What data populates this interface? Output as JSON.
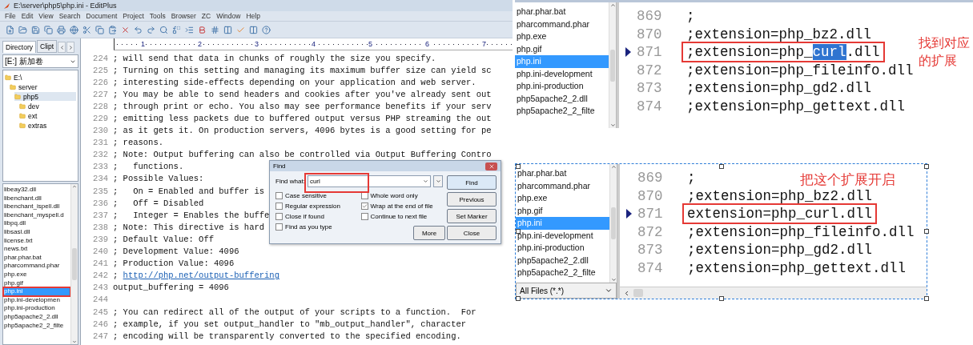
{
  "editor": {
    "title": "E:\\server\\php5\\php.ini - EditPlus",
    "menu": [
      "File",
      "Edit",
      "View",
      "Search",
      "Document",
      "Project",
      "Tools",
      "Browser",
      "ZC",
      "Window",
      "Help"
    ],
    "ruler": [
      "1",
      "2",
      "3",
      "4",
      "5",
      "6",
      "7"
    ],
    "sidebar": {
      "tabs": [
        {
          "label": "Directory",
          "selected": true
        },
        {
          "label": "Clipt",
          "selected": false
        }
      ],
      "drive": "[E:] 新加卷",
      "folders": [
        {
          "name": "E:\\",
          "selected": false,
          "children": [
            {
              "name": "server",
              "selected": false,
              "children": [
                {
                  "name": "php5",
                  "selected": true,
                  "children": [
                    {
                      "name": "dev",
                      "selected": false
                    },
                    {
                      "name": "ext",
                      "selected": false
                    },
                    {
                      "name": "extras",
                      "selected": false
                    }
                  ]
                }
              ]
            }
          ]
        }
      ],
      "files": [
        {
          "name": "libeay32.dll",
          "selected": false,
          "marked": false
        },
        {
          "name": "libenchant.dll",
          "selected": false,
          "marked": false
        },
        {
          "name": "libenchant_ispell.dll",
          "selected": false,
          "marked": false
        },
        {
          "name": "libenchant_myspell.d",
          "selected": false,
          "marked": false
        },
        {
          "name": "libpq.dll",
          "selected": false,
          "marked": false
        },
        {
          "name": "libsasl.dll",
          "selected": false,
          "marked": false
        },
        {
          "name": "license.txt",
          "selected": false,
          "marked": false
        },
        {
          "name": "news.txt",
          "selected": false,
          "marked": false
        },
        {
          "name": "phar.phar.bat",
          "selected": false,
          "marked": false
        },
        {
          "name": "pharcommand.phar",
          "selected": false,
          "marked": false
        },
        {
          "name": "php.exe",
          "selected": false,
          "marked": false
        },
        {
          "name": "php.gif",
          "selected": false,
          "marked": false
        },
        {
          "name": "php.ini",
          "selected": true,
          "marked": true
        },
        {
          "name": "php.ini-developmen",
          "selected": false,
          "marked": false
        },
        {
          "name": "php.ini-production",
          "selected": false,
          "marked": false
        },
        {
          "name": "php5apache2_2.dll",
          "selected": false,
          "marked": false
        },
        {
          "name": "php5apache2_2_filte",
          "selected": false,
          "marked": false
        }
      ]
    },
    "lines": [
      {
        "number": "224",
        "text": "; will send that data in chunks of roughly the size you specify."
      },
      {
        "number": "225",
        "text": "; Turning on this setting and managing its maximum buffer size can yield sc"
      },
      {
        "number": "226",
        "text": "; interesting side-effects depending on your application and web server."
      },
      {
        "number": "227",
        "text": "; You may be able to send headers and cookies after you've already sent out"
      },
      {
        "number": "228",
        "text": "; through print or echo. You also may see performance benefits if your serv"
      },
      {
        "number": "229",
        "text": "; emitting less packets due to buffered output versus PHP streaming the out"
      },
      {
        "number": "230",
        "text": "; as it gets it. On production servers, 4096 bytes is a good setting for pe"
      },
      {
        "number": "231",
        "text": "; reasons."
      },
      {
        "number": "232",
        "text": "; Note: Output buffering can also be controlled via Output Buffering Contro"
      },
      {
        "number": "233",
        "text": ";   functions."
      },
      {
        "number": "234",
        "text": "; Possible Values:"
      },
      {
        "number": "235",
        "text": ";   On = Enabled and buffer is"
      },
      {
        "number": "236",
        "text": ";   Off = Disabled"
      },
      {
        "number": "237",
        "text": ";   Integer = Enables the buffe"
      },
      {
        "number": "238",
        "text": "; Note: This directive is hard"
      },
      {
        "number": "239",
        "text": "; Default Value: Off"
      },
      {
        "number": "240",
        "text": "; Development Value: 4096"
      },
      {
        "number": "241",
        "text": "; Production Value: 4096"
      },
      {
        "number": "242",
        "text": "; ",
        "link": "http://php.net/output-buffering"
      },
      {
        "number": "243",
        "text": "output_buffering = 4096"
      },
      {
        "number": "244"
      },
      {
        "number": "245",
        "text": "; You can redirect all of the output of your scripts to a function.  For"
      },
      {
        "number": "246",
        "text": "; example, if you set output_handler to \"mb_output_handler\", character"
      },
      {
        "number": "247",
        "text": "; encoding will be transparently converted to the specified encoding."
      }
    ],
    "find_dialog": {
      "title": "Find",
      "label": "Find what:",
      "value": "curl",
      "marked": true,
      "options": [
        {
          "label": "Case sensitive",
          "checked": false
        },
        {
          "label": "Regular expression",
          "checked": false
        },
        {
          "label": "Close if found",
          "checked": false
        },
        {
          "label": "Find as you type",
          "checked": false
        },
        {
          "label": "Whole word only",
          "checked": false
        },
        {
          "label": "Wrap at the end of file",
          "checked": true
        },
        {
          "label": "Continue to next file",
          "checked": false
        }
      ],
      "buttons": [
        "Find",
        "Previous",
        "Set Marker",
        "More",
        "Close"
      ]
    }
  },
  "panels": [
    {
      "framed": false,
      "files": [
        {
          "name": "phar.phar.bat",
          "selected": false
        },
        {
          "name": "pharcommand.phar",
          "selected": false
        },
        {
          "name": "php.exe",
          "selected": false
        },
        {
          "name": "php.gif",
          "selected": false
        },
        {
          "name": "php.ini",
          "selected": true
        },
        {
          "name": "php.ini-development",
          "selected": false
        },
        {
          "name": "php.ini-production",
          "selected": false
        },
        {
          "name": "php5apache2_2.dll",
          "selected": false
        },
        {
          "name": "php5apache2_2_filte",
          "selected": false
        }
      ],
      "lines": [
        {
          "number": "869",
          "text": ";",
          "bookmark": false,
          "marked": false
        },
        {
          "number": "870",
          "text": ";extension=php_bz2.dll",
          "bookmark": false,
          "marked": false
        },
        {
          "number": "871",
          "text": ";extension=php_",
          "match": "curl",
          "rest": ".dll",
          "bookmark": true,
          "marked": true
        },
        {
          "number": "872",
          "text": ";extension=php_fileinfo.dll",
          "bookmark": false,
          "marked": false
        },
        {
          "number": "873",
          "text": ";extension=php_gd2.dll",
          "bookmark": false,
          "marked": false
        },
        {
          "number": "874",
          "text": ";extension=php_gettext.dll",
          "bookmark": false,
          "marked": false
        }
      ],
      "note": {
        "kind": "side",
        "text": "找到对应的扩展"
      }
    },
    {
      "framed": true,
      "filter": "All Files (*.*)",
      "files": [
        {
          "name": "phar.phar.bat",
          "selected": false
        },
        {
          "name": "pharcommand.phar",
          "selected": false
        },
        {
          "name": "php.exe",
          "selected": false
        },
        {
          "name": "php.gif",
          "selected": false
        },
        {
          "name": "php.ini",
          "selected": true
        },
        {
          "name": "php.ini-development",
          "selected": false
        },
        {
          "name": "php.ini-production",
          "selected": false
        },
        {
          "name": "php5apache2_2.dll",
          "selected": false
        },
        {
          "name": "php5apache2_2_filte",
          "selected": false
        }
      ],
      "lines": [
        {
          "number": "869",
          "text": ";",
          "bookmark": false,
          "marked": false
        },
        {
          "number": "870",
          "text": ";extension=php_bz2.dll",
          "bookmark": false,
          "marked": false
        },
        {
          "number": "871",
          "text": "extension=php_curl.dll",
          "bookmark": true,
          "marked": true
        },
        {
          "number": "872",
          "text": ";extension=php_fileinfo.dll",
          "bookmark": false,
          "marked": false
        },
        {
          "number": "873",
          "text": ";extension=php_gd2.dll",
          "bookmark": false,
          "marked": false
        },
        {
          "number": "874",
          "text": ";extension=php_gettext.dll",
          "bookmark": false,
          "marked": false
        }
      ],
      "note": {
        "kind": "overlay",
        "text": "把这个扩展开启"
      }
    }
  ]
}
